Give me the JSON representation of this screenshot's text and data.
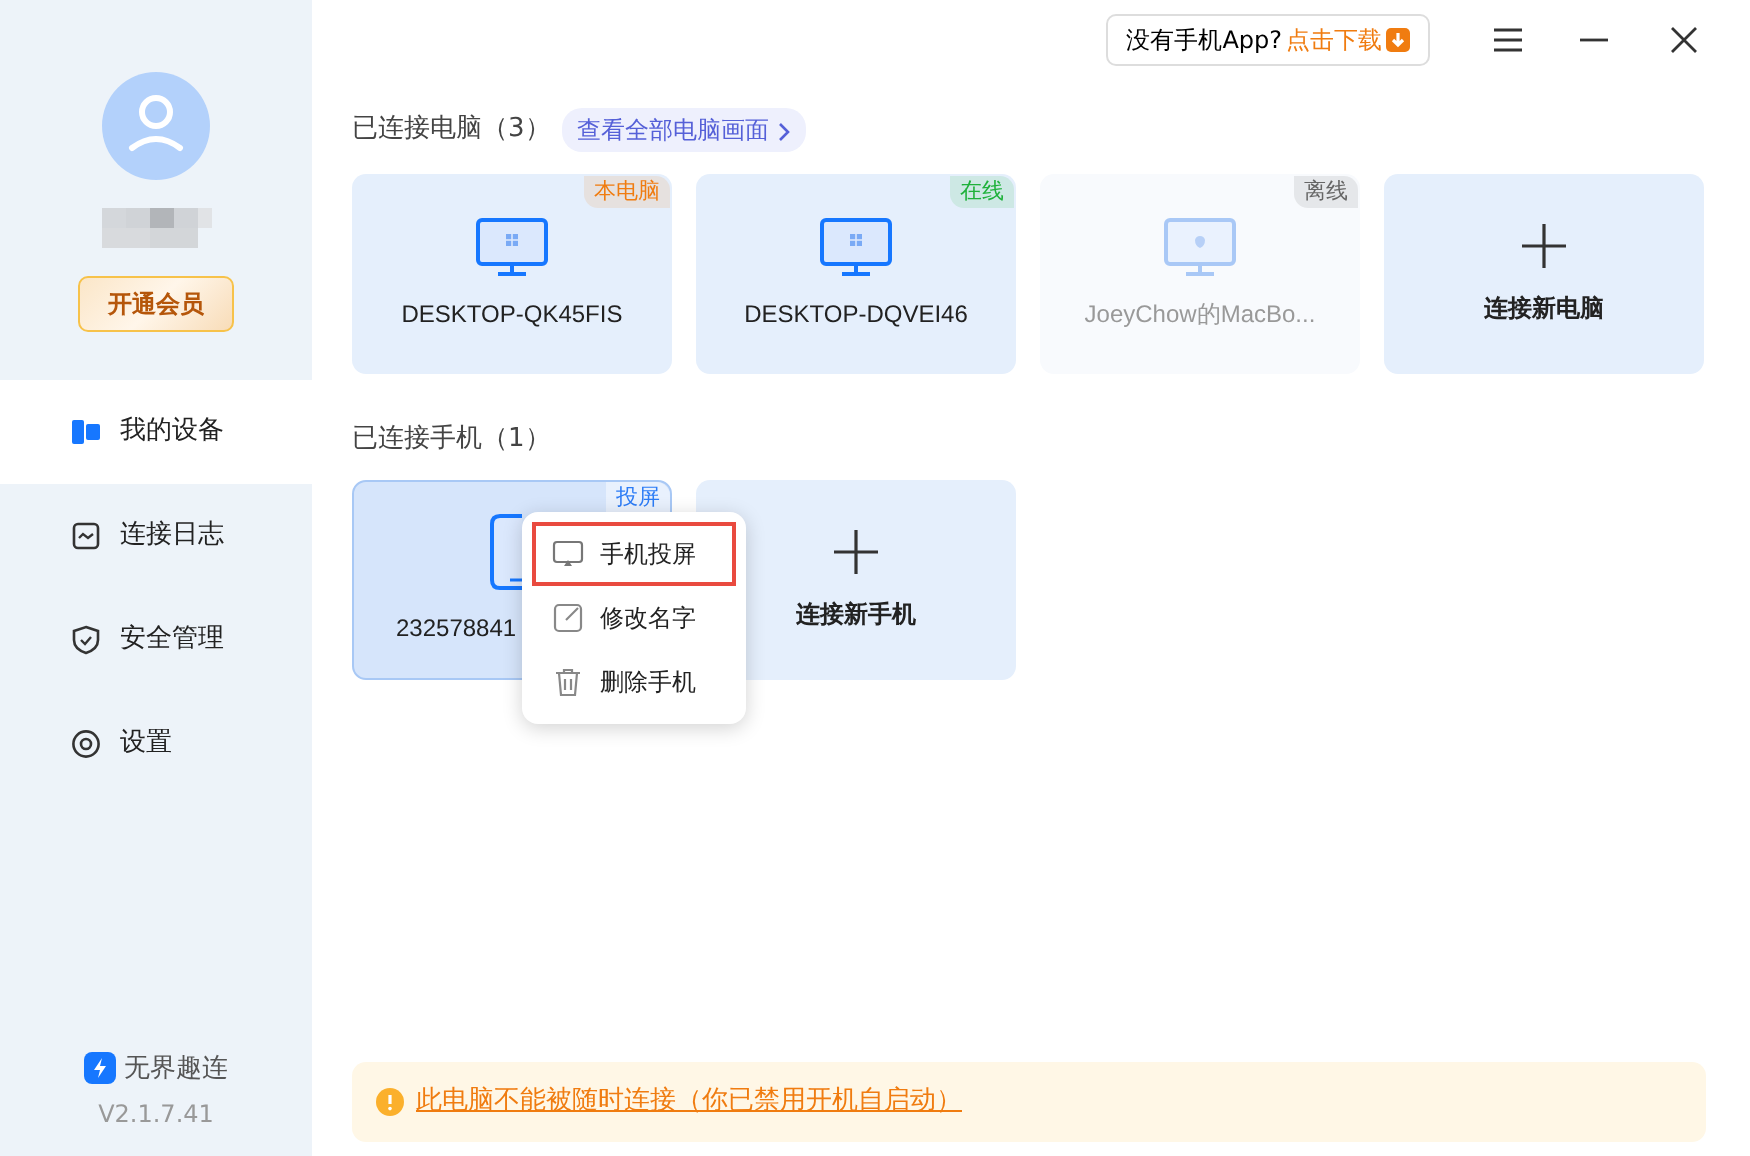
{
  "sidebar": {
    "member_button": "开通会员",
    "items": [
      {
        "label": "我的设备",
        "selected": true
      },
      {
        "label": "连接日志",
        "selected": false
      },
      {
        "label": "安全管理",
        "selected": false
      },
      {
        "label": "设置",
        "selected": false
      }
    ],
    "brand": "无界趣连",
    "version": "V2.1.7.41"
  },
  "topbar": {
    "download_prompt": "没有手机App?",
    "download_link": "点击下载"
  },
  "computers": {
    "title": "已连接电脑（3）",
    "view_all": "查看全部电脑画面",
    "cards": [
      {
        "kind": "windows",
        "name": "DESKTOP-QK45FIS",
        "badge": "本电脑",
        "color": "#f07c10",
        "online": true
      },
      {
        "kind": "windows",
        "name": "DESKTOP-DQVEI46",
        "badge": "在线",
        "color": "#1fb13b",
        "online": true
      },
      {
        "kind": "mac",
        "name": "JoeyChow的MacBo...",
        "badge": "离线",
        "color": "#666666",
        "online": false
      },
      {
        "kind": "add",
        "name": "连接新电脑"
      }
    ]
  },
  "phones": {
    "title": "已连接手机（1）",
    "cards": [
      {
        "kind": "device",
        "name": "232578841",
        "badge": "投屏",
        "selected": true
      },
      {
        "kind": "add",
        "name": "连接新手机"
      }
    ]
  },
  "context_menu": [
    {
      "label": "手机投屏",
      "highlighted": true
    },
    {
      "label": "修改名字",
      "highlighted": false
    },
    {
      "label": "删除手机",
      "highlighted": false
    }
  ],
  "notice": "此电脑不能被随时连接（你已禁用开机自启动）"
}
